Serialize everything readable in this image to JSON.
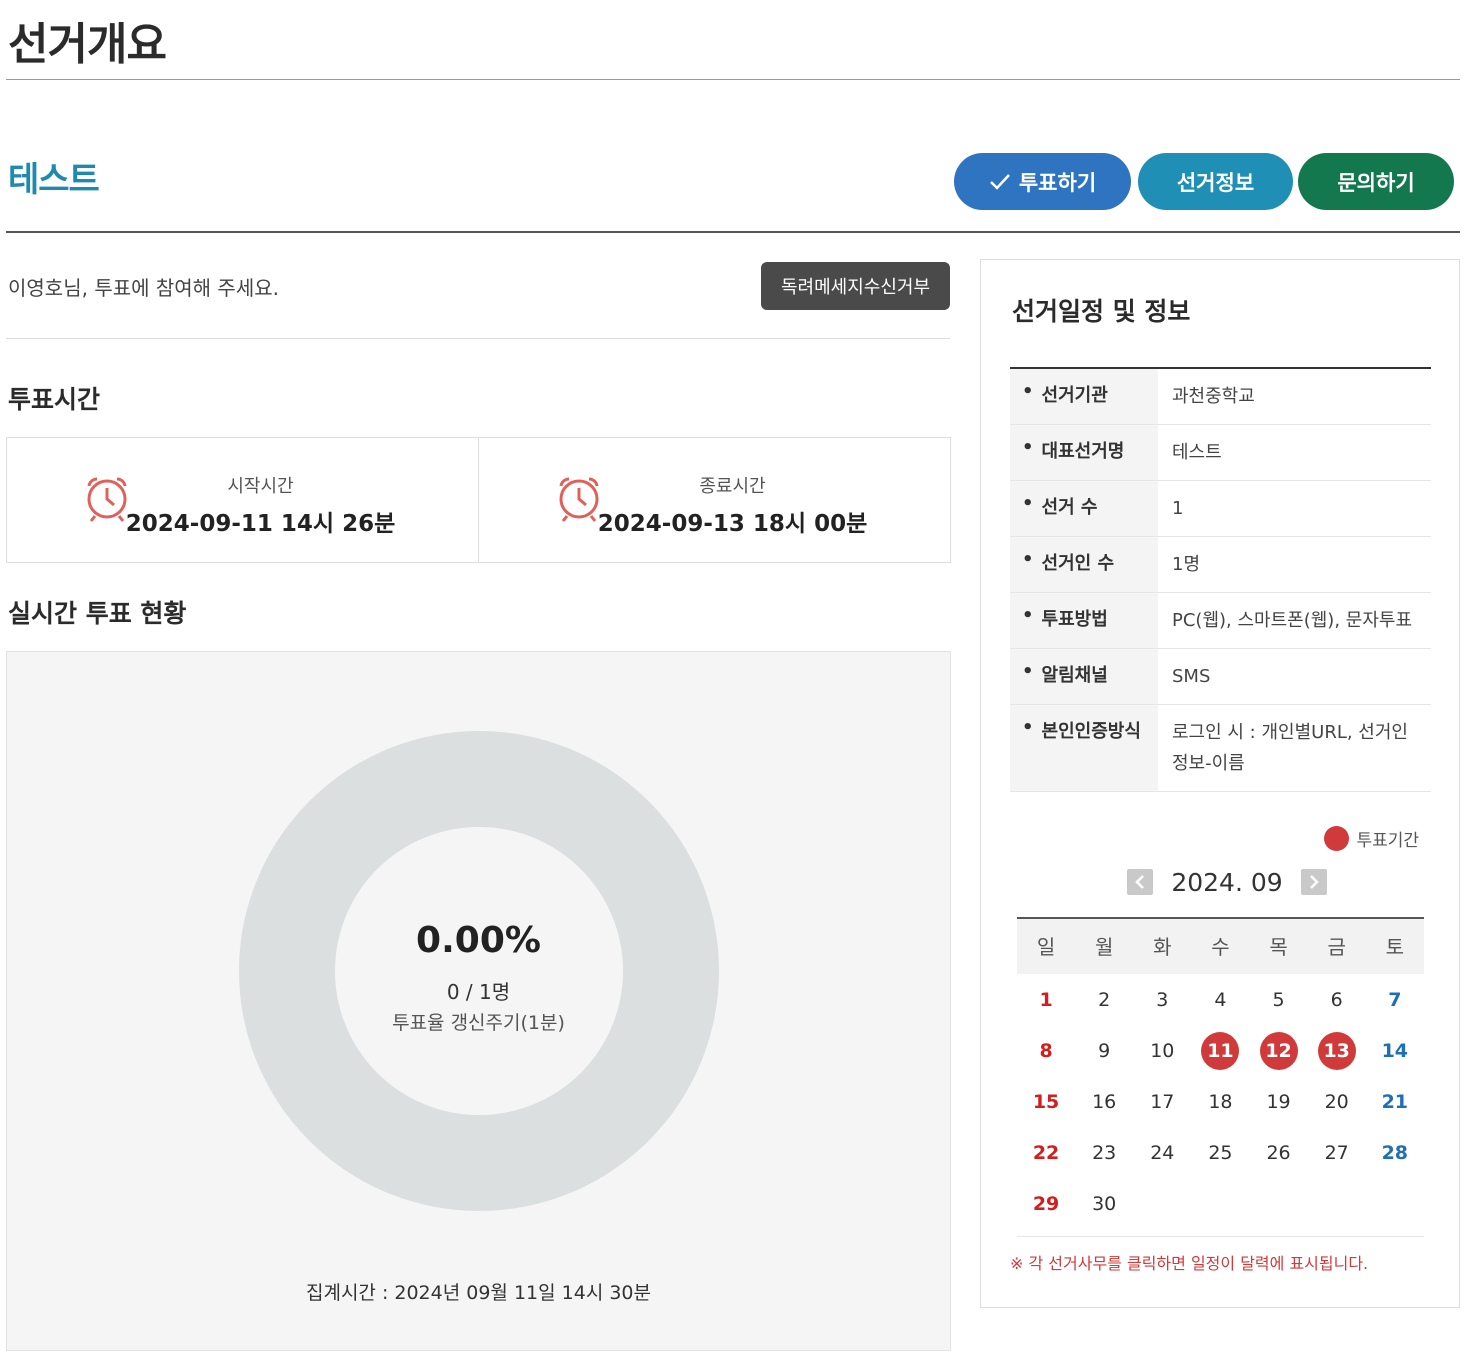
{
  "page": {
    "title": "선거개요"
  },
  "election": {
    "name": "테스트"
  },
  "actions": {
    "vote_label": "투표하기",
    "info_label": "선거정보",
    "ask_label": "문의하기"
  },
  "greeting": "이영호님, 투표에 참여해 주세요.",
  "reject_label": "독려메세지수신거부",
  "vote_time": {
    "heading": "투표시간",
    "start_label": "시작시간",
    "start_value": "2024-09-11 14시 26분",
    "end_label": "종료시간",
    "end_value": "2024-09-13 18시 00분"
  },
  "live_status": {
    "heading": "실시간 투표 현황",
    "percent": "0.00%",
    "count": "0 / 1명",
    "refresh": "투표율 갱신주기(1분)",
    "aggregate": "집계시간 : 2024년 09월 11일 14시 30분",
    "turnout_fraction": 0
  },
  "sidebar": {
    "title": "선거일정 및 정보",
    "rows": [
      {
        "key": "선거기관",
        "value": "과천중학교"
      },
      {
        "key": "대표선거명",
        "value": "테스트"
      },
      {
        "key": "선거 수",
        "value": "1"
      },
      {
        "key": "선거인 수",
        "value": "1명"
      },
      {
        "key": "투표방법",
        "value": "PC(웹), 스마트폰(웹), 문자투표"
      },
      {
        "key": "알림채널",
        "value": "SMS"
      },
      {
        "key": "본인인증방식",
        "value": "로그인 시 : 개인별URL, 선거인 정보-이름"
      }
    ],
    "legend": "투표기간",
    "calendar": {
      "month": "2024. 09",
      "weekdays": [
        "일",
        "월",
        "화",
        "수",
        "목",
        "금",
        "토"
      ],
      "weeks": [
        [
          "1",
          "2",
          "3",
          "4",
          "5",
          "6",
          "7"
        ],
        [
          "8",
          "9",
          "10",
          "11",
          "12",
          "13",
          "14"
        ],
        [
          "15",
          "16",
          "17",
          "18",
          "19",
          "20",
          "21"
        ],
        [
          "22",
          "23",
          "24",
          "25",
          "26",
          "27",
          "28"
        ],
        [
          "29",
          "30",
          "",
          "",
          "",
          "",
          ""
        ]
      ],
      "vote_days": [
        "11",
        "12",
        "13"
      ]
    },
    "note": "※ 각 선거사무를 클릭하면 일정이 달력에 표시됩니다."
  },
  "colors": {
    "accent": "#1f8ab0",
    "vote": "#2f74c0",
    "info": "#1f8fb5",
    "ask": "#14784f",
    "highlight": "#d13a3a",
    "sunday": "#d21e1e",
    "saturday": "#1f6fb5"
  },
  "icons": {
    "vote": "check-icon",
    "clock": "alarm-clock-icon",
    "prev": "chevron-left-icon",
    "next": "chevron-right-icon"
  }
}
